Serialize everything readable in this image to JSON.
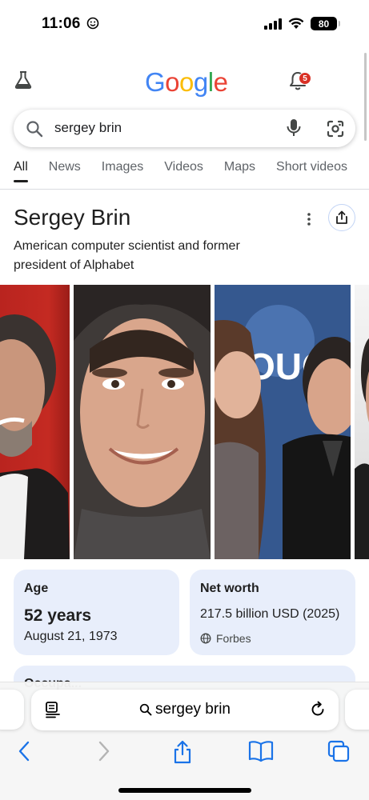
{
  "status_bar": {
    "time": "11:06",
    "battery": "80"
  },
  "google": {
    "logo_letters": [
      {
        "ch": "G",
        "color": "#4285F4"
      },
      {
        "ch": "o",
        "color": "#EA4335"
      },
      {
        "ch": "o",
        "color": "#FBBC05"
      },
      {
        "ch": "g",
        "color": "#4285F4"
      },
      {
        "ch": "l",
        "color": "#34A853"
      },
      {
        "ch": "e",
        "color": "#EA4335"
      }
    ],
    "notification_count": "5"
  },
  "search": {
    "query": "sergey brin"
  },
  "tabs": [
    {
      "label": "All",
      "active": true
    },
    {
      "label": "News",
      "active": false
    },
    {
      "label": "Images",
      "active": false
    },
    {
      "label": "Videos",
      "active": false
    },
    {
      "label": "Maps",
      "active": false
    },
    {
      "label": "Short videos",
      "active": false
    }
  ],
  "knowledge_panel": {
    "title": "Sergey Brin",
    "subtitle": "American computer scientist and former president of Alphabet",
    "photos": [
      {
        "name": "photo-red-background"
      },
      {
        "name": "photo-closeup-portrait"
      },
      {
        "name": "photo-event-with-woman"
      },
      {
        "name": "photo-partial"
      }
    ],
    "cards": {
      "age": {
        "label": "Age",
        "value": "52 years",
        "detail": "August 21, 1973"
      },
      "net_worth": {
        "label": "Net worth",
        "value": "217.5 billion USD (2025)",
        "source": "Forbes"
      },
      "peek_label": "Occupa..."
    }
  },
  "browser": {
    "address": "sergey brin"
  },
  "colors": {
    "accent_blue": "#1a73e8",
    "card_bg": "#e8eefb",
    "badge_red": "#d93025"
  }
}
